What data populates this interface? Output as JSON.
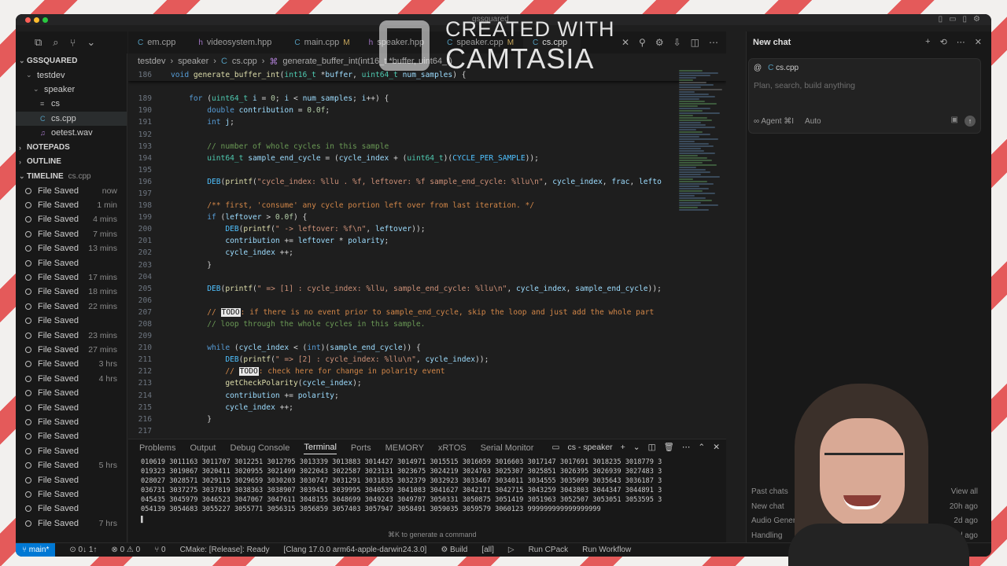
{
  "window": {
    "title": "gssquared"
  },
  "explorer": {
    "root": "GSSQUARED",
    "items": [
      {
        "label": "testdev",
        "indent": 1,
        "chevron": "⌄"
      },
      {
        "label": "speaker",
        "indent": 2,
        "chevron": "⌄"
      },
      {
        "label": "cs",
        "indent": 3,
        "icon": "≡"
      },
      {
        "label": "cs.cpp",
        "indent": 3,
        "icon": "C"
      },
      {
        "label": "oetest.wav",
        "indent": 3,
        "icon": "♫"
      }
    ],
    "notepads": "NOTEPADS",
    "outline": "OUTLINE",
    "timeline_header": "TIMELINE",
    "timeline_file": "cs.cpp"
  },
  "timeline": [
    {
      "label": "File Saved",
      "time": "now"
    },
    {
      "label": "File Saved",
      "time": "1 min"
    },
    {
      "label": "File Saved",
      "time": "4 mins"
    },
    {
      "label": "File Saved",
      "time": "7 mins"
    },
    {
      "label": "File Saved",
      "time": "13 mins"
    },
    {
      "label": "File Saved",
      "time": ""
    },
    {
      "label": "File Saved",
      "time": "17 mins"
    },
    {
      "label": "File Saved",
      "time": "18 mins"
    },
    {
      "label": "File Saved",
      "time": "22 mins"
    },
    {
      "label": "File Saved",
      "time": ""
    },
    {
      "label": "File Saved",
      "time": "23 mins"
    },
    {
      "label": "File Saved",
      "time": "27 mins"
    },
    {
      "label": "File Saved",
      "time": "3 hrs"
    },
    {
      "label": "File Saved",
      "time": "4 hrs"
    },
    {
      "label": "File Saved",
      "time": ""
    },
    {
      "label": "File Saved",
      "time": ""
    },
    {
      "label": "File Saved",
      "time": ""
    },
    {
      "label": "File Saved",
      "time": ""
    },
    {
      "label": "File Saved",
      "time": ""
    },
    {
      "label": "File Saved",
      "time": "5 hrs"
    },
    {
      "label": "File Saved",
      "time": ""
    },
    {
      "label": "File Saved",
      "time": ""
    },
    {
      "label": "File Saved",
      "time": ""
    },
    {
      "label": "File Saved",
      "time": "7 hrs"
    }
  ],
  "tabs": [
    {
      "label": "em.cpp",
      "modified": "",
      "active": false
    },
    {
      "label": "videosystem.hpp",
      "modified": "",
      "active": false
    },
    {
      "label": "main.cpp",
      "modified": "M",
      "active": false
    },
    {
      "label": "speaker.hpp",
      "modified": "",
      "active": false
    },
    {
      "label": "speaker.cpp",
      "modified": "M",
      "active": false
    },
    {
      "label": "cs.cpp",
      "modified": "",
      "active": true
    }
  ],
  "breadcrumb": [
    "testdev",
    "speaker",
    "cs.cpp",
    "generate_buffer_int(int16_t *buffer, uint64_t)"
  ],
  "code": [
    {
      "n": "186",
      "sticky": true,
      "h": "<span class='kw'>void</span> <span class='fn'>generate_buffer_int</span>(<span class='ty'>int16_t</span> *<span class='vr'>buffer</span>, <span class='ty'>uint64_t</span> <span class='vr'>num_samples</span>) {"
    },
    {
      "n": "",
      "h": ""
    },
    {
      "n": "189",
      "h": "    <span class='kw'>for</span> (<span class='ty'>uint64_t</span> <span class='vr'>i</span> = <span class='nm'>0</span>; <span class='vr'>i</span> &lt; <span class='vr'>num_samples</span>; <span class='vr'>i</span>++) {"
    },
    {
      "n": "190",
      "h": "        <span class='kw'>double</span> <span class='vr'>contribution</span> = <span class='nm'>0.0f</span>;"
    },
    {
      "n": "191",
      "h": "        <span class='kw'>int</span> <span class='vr'>j</span>;"
    },
    {
      "n": "192",
      "h": ""
    },
    {
      "n": "193",
      "h": "        <span class='cm'>// number of whole cycles in this sample</span>"
    },
    {
      "n": "194",
      "h": "        <span class='ty'>uint64_t</span> <span class='vr'>sample_end_cycle</span> = (<span class='vr'>cycle_index</span> + (<span class='ty'>uint64_t</span>)(<span class='mc'>CYCLE_PER_SAMPLE</span>));"
    },
    {
      "n": "195",
      "h": ""
    },
    {
      "n": "196",
      "h": "        <span class='mc'>DEB</span>(<span class='fn'>printf</span>(<span class='st'>\"cycle_index: %llu . %f, leftover: %f sample_end_cycle: %llu\\n\"</span>, <span class='vr'>cycle_index</span>, <span class='vr'>frac</span>, <span class='vr'>lefto</span>"
    },
    {
      "n": "197",
      "h": ""
    },
    {
      "n": "198",
      "h": "        <span class='cm-o'>/** first, 'consume' any cycle portion left over from last iteration. */</span>"
    },
    {
      "n": "199",
      "h": "        <span class='kw'>if</span> (<span class='vr'>leftover</span> &gt; <span class='nm'>0.0f</span>) {"
    },
    {
      "n": "200",
      "h": "            <span class='mc'>DEB</span>(<span class='fn'>printf</span>(<span class='st'>\" -&gt; leftover: %f\\n\"</span>, <span class='vr'>leftover</span>));"
    },
    {
      "n": "201",
      "h": "            <span class='vr'>contribution</span> += <span class='vr'>leftover</span> * <span class='vr'>polarity</span>;"
    },
    {
      "n": "202",
      "h": "            <span class='vr'>cycle_index</span> ++;"
    },
    {
      "n": "203",
      "h": "        }"
    },
    {
      "n": "204",
      "h": ""
    },
    {
      "n": "205",
      "h": "        <span class='mc'>DEB</span>(<span class='fn'>printf</span>(<span class='st'>\" =&gt; [1] : cycle_index: %llu, sample_end_cycle: %llu\\n\"</span>, <span class='vr'>cycle_index</span>, <span class='vr'>sample_end_cycle</span>));"
    },
    {
      "n": "206",
      "h": ""
    },
    {
      "n": "207",
      "h": "        <span class='cm-o'>// <span class='todo'>TODO</span>: if there is no event prior to sample_end_cycle, skip the loop and just add the whole part</span>"
    },
    {
      "n": "208",
      "h": "        <span class='cm'>// loop through the whole cycles in this sample.</span>"
    },
    {
      "n": "209",
      "h": ""
    },
    {
      "n": "210",
      "h": "        <span class='kw'>while</span> (<span class='vr'>cycle_index</span> &lt; (<span class='kw'>int</span>)(<span class='vr'>sample_end_cycle</span>)) {"
    },
    {
      "n": "211",
      "h": "            <span class='mc'>DEB</span>(<span class='fn'>printf</span>(<span class='st'>\" =&gt; [2] : cycle_index: %llu\\n\"</span>, <span class='vr'>cycle_index</span>));"
    },
    {
      "n": "212",
      "h": "            <span class='cm-o'>// <span class='todo'>TODO</span>: check here for change in polarity event</span>"
    },
    {
      "n": "213",
      "h": "            <span class='fn'>getCheckPolarity</span>(<span class='vr'>cycle_index</span>);"
    },
    {
      "n": "214",
      "h": "            <span class='vr'>contribution</span> += <span class='vr'>polarity</span>;"
    },
    {
      "n": "215",
      "h": "            <span class='vr'>cycle_index</span> ++;"
    },
    {
      "n": "216",
      "h": "        }"
    },
    {
      "n": "217",
      "h": ""
    }
  ],
  "panel": {
    "tabs": [
      "Problems",
      "Output",
      "Debug Console",
      "Terminal",
      "Ports",
      "MEMORY",
      "xRTOS",
      "Serial Monitor"
    ],
    "active_tab": "Terminal",
    "terminal_name": "cs - speaker",
    "lines": [
      "010619 3011163 3011707 3012251 3012795 3013339 3013883 3014427 3014971 3015515 3016059 3016603 3017147 3017691 3018235 3018779 3",
      "019323 3019867 3020411 3020955 3021499 3022043 3022587 3023131 3023675 3024219 3024763 3025307 3025851 3026395 3026939 3027483 3",
      "028027 3028571 3029115 3029659 3030203 3030747 3031291 3031835 3032379 3032923 3033467 3034011 3034555 3035099 3035643 3036187 3",
      "036731 3037275 3037819 3038363 3038907 3039451 3039995 3040539 3041083 3041627 3042171 3042715 3043259 3043803 3044347 3044891 3",
      "045435 3045979 3046523 3047067 3047611 3048155 3048699 3049243 3049787 3050331 3050875 3051419 3051963 3052507 3053051 3053595 3",
      "054139 3054683 3055227 3055771 3056315 3056859 3057403 3057947 3058491 3059035 3059579 3060123 999999999999999999",
      "▌"
    ],
    "hint": "⌘K to generate a command"
  },
  "statusbar": {
    "branch": "main*",
    "sync": "⊙ 0↓ 1↑",
    "problems": "⊗ 0 ⚠ 0",
    "ports": "⑂ 0",
    "cmake": "CMake: [Release]: Ready",
    "kit": "[Clang 17.0.0 arm64-apple-darwin24.3.0]",
    "build": "⚙ Build",
    "target": "[all]",
    "run": "▷",
    "cpack": "Run CPack",
    "workflow": "Run Workflow"
  },
  "chat": {
    "title": "New chat",
    "context_at": "@",
    "context_file": "cs.cpp",
    "placeholder": "Plan, search, build anything",
    "mode": "∞ Agent ⌘I",
    "model": "Auto",
    "past_header": "Past chats",
    "view_all": "View all",
    "past": [
      {
        "title": "New chat",
        "age": "20h ago"
      },
      {
        "title": "Audio Generation",
        "age": "2d ago"
      },
      {
        "title": "Handling",
        "age": "2d ago"
      }
    ]
  },
  "watermark": {
    "top": "CREATED WITH",
    "bottom": "CAMTASIA"
  },
  "colors": {
    "accent": "#0078d4",
    "todo_bg": "#e8e8e8",
    "traffic_red": "#ff5f57",
    "traffic_yellow": "#febc2e",
    "traffic_green": "#28c840"
  }
}
